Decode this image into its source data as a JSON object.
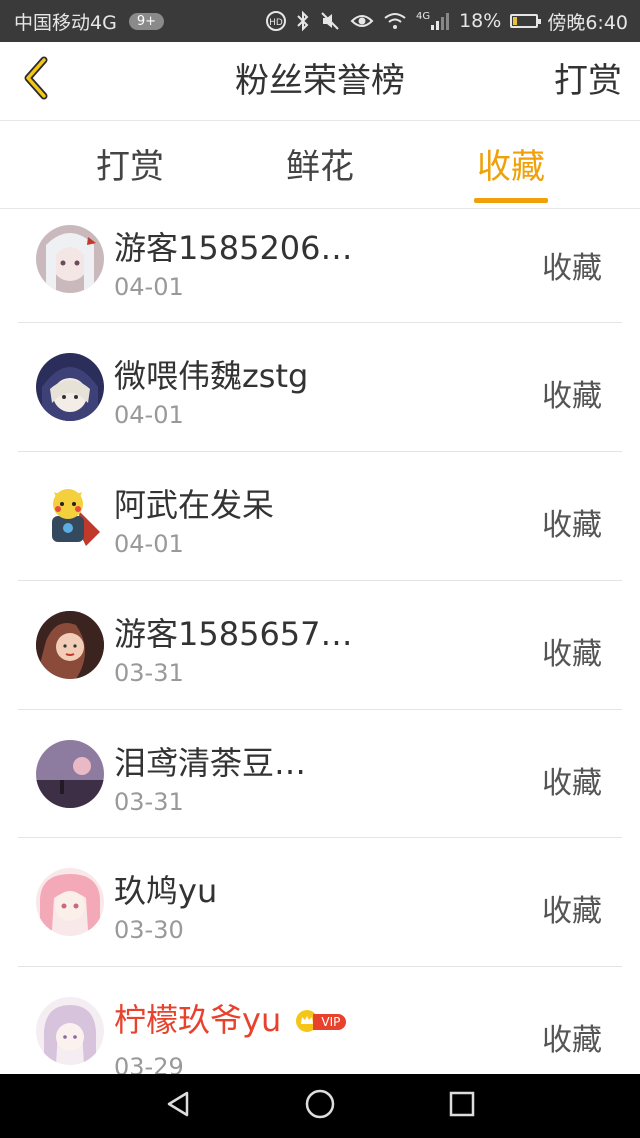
{
  "status_bar": {
    "carrier": "中国移动4G",
    "badge": "9+",
    "network_type": "4G",
    "battery_percent": "18%",
    "battery_level": 0.18,
    "time": "傍晚6:40",
    "icons": [
      "hd-call-icon",
      "bluetooth-icon",
      "mute-icon",
      "eye-icon",
      "wifi-icon",
      "signal-icon",
      "battery-icon"
    ]
  },
  "header": {
    "back_icon": "chevron-left-icon",
    "title": "粉丝荣誉榜",
    "right_action": "打赏"
  },
  "tabs": [
    {
      "label": "打赏",
      "active": false
    },
    {
      "label": "鲜花",
      "active": false
    },
    {
      "label": "收藏",
      "active": true
    }
  ],
  "colors": {
    "accent": "#f0a10a",
    "vip_name": "#e8412c"
  },
  "fans": [
    {
      "name": "游客1585206…",
      "date": "04-01",
      "action": "收藏",
      "vip": false
    },
    {
      "name": "微喂伟魏zstg",
      "date": "04-01",
      "action": "收藏",
      "vip": false
    },
    {
      "name": "阿武在发呆",
      "date": "04-01",
      "action": "收藏",
      "vip": false
    },
    {
      "name": "游客1585657…",
      "date": "03-31",
      "action": "收藏",
      "vip": false
    },
    {
      "name": "泪鸢清荼豆…",
      "date": "03-31",
      "action": "收藏",
      "vip": false
    },
    {
      "name": "玖鸠yu",
      "date": "03-30",
      "action": "收藏",
      "vip": false
    },
    {
      "name": "柠檬玖爷yu",
      "date": "03-29",
      "action": "收藏",
      "vip": true,
      "vip_label": "VIP"
    }
  ],
  "nav_bar": {
    "icons": [
      "back-triangle-icon",
      "home-circle-icon",
      "recents-square-icon"
    ]
  }
}
